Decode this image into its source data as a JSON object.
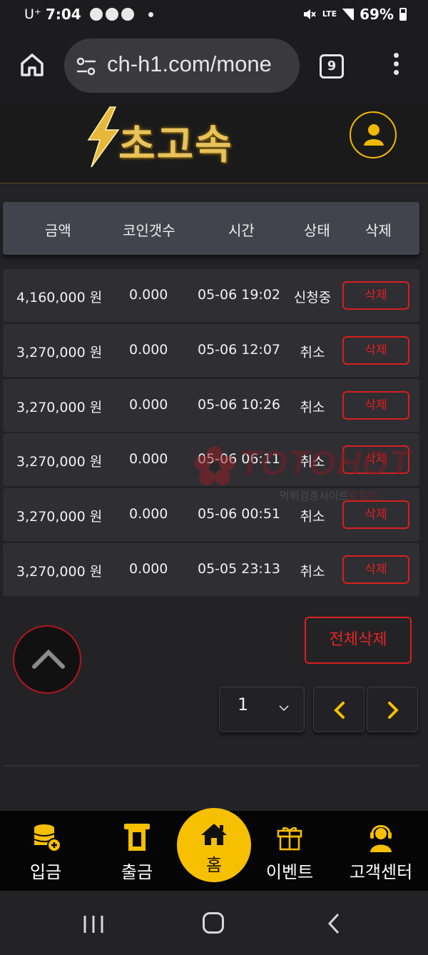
{
  "status_bar": {
    "carrier": "U⁺",
    "time": "7:04",
    "network": "LTE",
    "battery": "69%"
  },
  "browser": {
    "url": "ch-h1.com/mone",
    "tab_count": "9"
  },
  "site": {
    "logo_text": "초고속"
  },
  "table": {
    "headers": [
      "금액",
      "코인갯수",
      "시간",
      "상태",
      "삭제"
    ],
    "rows": [
      {
        "amount": "4,160,000 원",
        "coins": "0.000",
        "time": "05-06 19:02",
        "status": "신청중",
        "delete_label": "삭제"
      },
      {
        "amount": "3,270,000 원",
        "coins": "0.000",
        "time": "05-06 12:07",
        "status": "취소",
        "delete_label": "삭제"
      },
      {
        "amount": "3,270,000 원",
        "coins": "0.000",
        "time": "05-06 10:26",
        "status": "취소",
        "delete_label": "삭제"
      },
      {
        "amount": "3,270,000 원",
        "coins": "0.000",
        "time": "05-06 06:11",
        "status": "취소",
        "delete_label": "삭제"
      },
      {
        "amount": "3,270,000 원",
        "coins": "0.000",
        "time": "05-06 00:51",
        "status": "취소",
        "delete_label": "삭제"
      },
      {
        "amount": "3,270,000 원",
        "coins": "0.000",
        "time": "05-05 23:13",
        "status": "취소",
        "delete_label": "삭제"
      }
    ]
  },
  "watermark": {
    "brand": "TOTOHOT",
    "sub_gray": "먹튀검증사이트",
    "sub_red": "토토핫"
  },
  "controls": {
    "delete_all_label": "전체삭제",
    "page_select_value": "1"
  },
  "bottom_nav": {
    "deposit": "입금",
    "withdraw": "출금",
    "home": "홈",
    "event": "이벤트",
    "support": "고객센터"
  },
  "colors": {
    "accent_gold": "#f6c000",
    "delete_red": "#d81f1f",
    "row_bg": "#2e2e33",
    "header_bg": "#43434d"
  }
}
